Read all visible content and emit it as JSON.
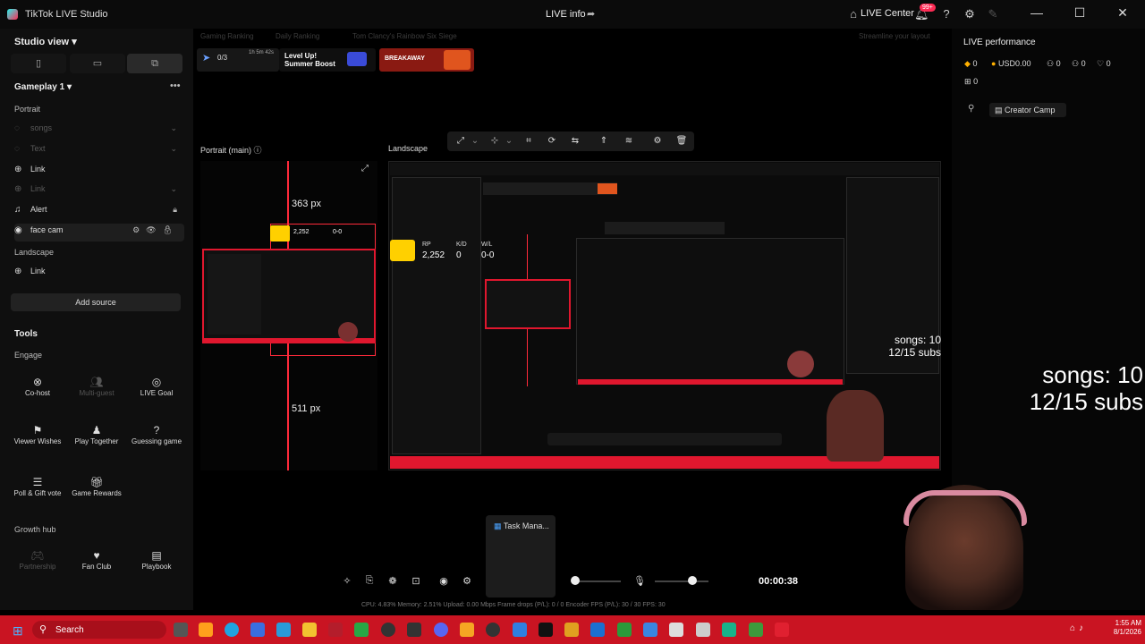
{
  "app": {
    "title": "TikTok LIVE Studio",
    "center_title": "LIVE info",
    "live_center": "LIVE Center",
    "notif_badge": "99+"
  },
  "sidebar": {
    "studio_view": "Studio view",
    "scene": "Gameplay 1",
    "groups": {
      "portrait": "Portrait",
      "landscape": "Landscape"
    },
    "sources_portrait": [
      {
        "label": "songs",
        "dim": true
      },
      {
        "label": "Text",
        "dim": true
      },
      {
        "label": "Link",
        "dim": false
      },
      {
        "label": "Link",
        "dim": true
      },
      {
        "label": "Alert",
        "dim": false
      },
      {
        "label": "face cam",
        "dim": false
      }
    ],
    "sources_landscape": [
      {
        "label": "Link"
      }
    ],
    "add_source": "Add source",
    "tools_title": "Tools",
    "engage_title": "Engage",
    "growth_title": "Growth hub",
    "tools": [
      {
        "label": "Co-host",
        "icon": "co-host-icon"
      },
      {
        "label": "Multi-guest",
        "icon": "multi-guest-icon"
      },
      {
        "label": "LIVE Goal",
        "icon": "goal-icon"
      },
      {
        "label": "Viewer Wishes",
        "icon": "wishes-icon"
      },
      {
        "label": "Play Together",
        "icon": "play-together-icon"
      },
      {
        "label": "Guessing game",
        "icon": "guessing-icon"
      },
      {
        "label": "Poll & Gift vote",
        "icon": "poll-icon"
      },
      {
        "label": "Game Rewards",
        "icon": "rewards-icon"
      },
      {
        "label": "Partnership",
        "icon": "partnership-icon"
      },
      {
        "label": "Fan Club",
        "icon": "fan-club-icon"
      },
      {
        "label": "Playbook",
        "icon": "playbook-icon"
      }
    ]
  },
  "top": {
    "categories": [
      "Gaming Ranking",
      "Daily Ranking",
      "Tom Clancy's Rainbow Six Siege"
    ],
    "stream_layout": "Streamline your layout",
    "progress": "0/3",
    "timer_small": "1h 5m 42s",
    "promo": "Level Up! Summer Boost",
    "breakaway": "BREAKAWAY"
  },
  "preview": {
    "portrait_label": "Portrait (main)",
    "landscape_label": "Landscape",
    "top_px": "363 px",
    "bottom_px": "511 px",
    "overlay": {
      "rp": "RP",
      "rp_value": "2,252",
      "kd": "K/D",
      "kd_value": "0",
      "wl": "W/L",
      "wl_value": "0-0"
    },
    "songs": "songs: 10",
    "subs": "12/15 subs"
  },
  "right": {
    "title": "LIVE performance",
    "stats": [
      "0",
      "USD0.00",
      "0",
      "0",
      "0",
      "0"
    ],
    "creator_camp": "Creator Camp"
  },
  "bottom": {
    "timer": "00:00:38",
    "stats": "CPU: 4.83%    Memory: 2.51%    Upload: 0.00 Mbps    Frame drops (P/L): 0 / 0    Encoder FPS (P/L): 30 / 30    FPS: 30",
    "taskmanager": "Task Mana..."
  },
  "taskbar": {
    "search": "Search",
    "time": "1:55 AM",
    "date": "8/1/2026"
  },
  "colors": {
    "accent": "#fe2c55",
    "taskbar": "#c91422",
    "gold": "#ffd000"
  }
}
